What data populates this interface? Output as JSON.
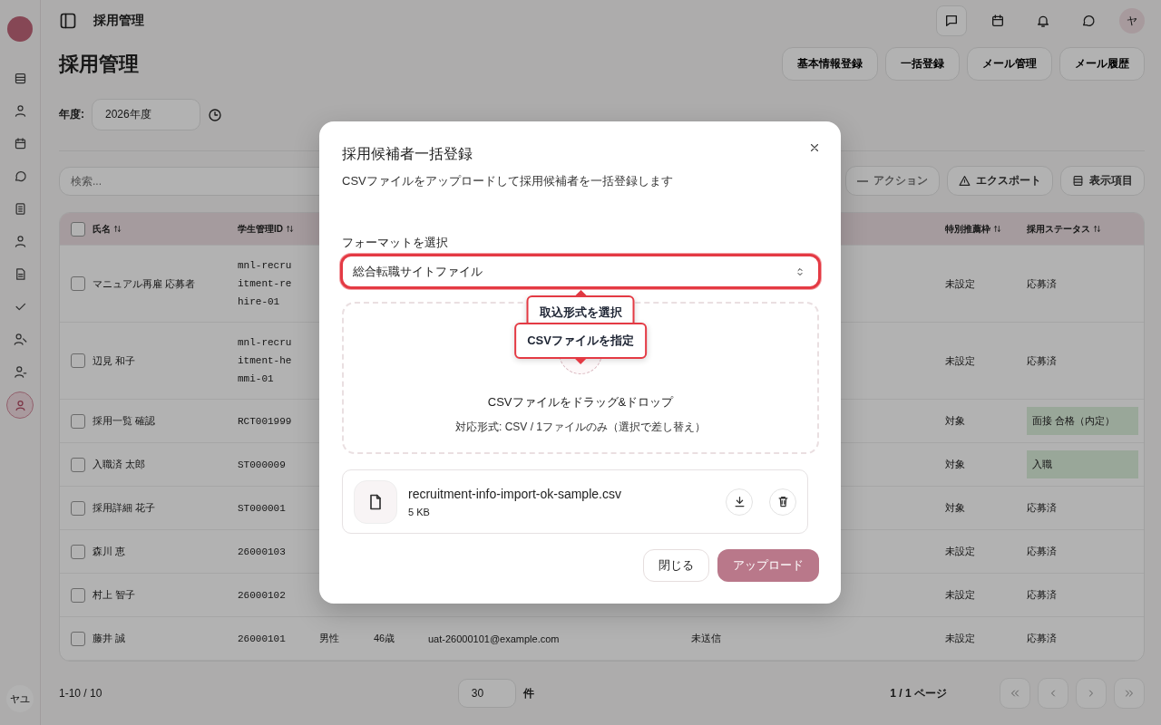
{
  "sidebar": {
    "items": [
      {
        "selected": false
      },
      {
        "selected": false
      },
      {
        "selected": false
      },
      {
        "selected": false
      },
      {
        "selected": false
      },
      {
        "selected": false
      },
      {
        "selected": false
      },
      {
        "selected": false
      },
      {
        "selected": false
      },
      {
        "selected": false
      },
      {
        "selected": true
      }
    ],
    "user": "ヤユ"
  },
  "header": {
    "title": "採用管理",
    "avatar": "ヤ"
  },
  "page": {
    "title": "採用管理",
    "actions": [
      "基本情報登録",
      "一括登録",
      "メール管理",
      "メール履歴"
    ],
    "year_label": "年度:",
    "year_value": "2026年度"
  },
  "toolbar": {
    "search_placeholder": "検索...",
    "buttons": [
      {
        "label": "アクション",
        "kind": "minus",
        "disabled": true
      },
      {
        "label": "エクスポート",
        "kind": "warning",
        "disabled": false
      },
      {
        "label": "表示項目",
        "kind": "columns",
        "disabled": false
      }
    ]
  },
  "table": {
    "select_all_checked": false,
    "columns": [
      "氏名",
      "学生管理ID",
      "特別推薦枠",
      "採用ステータス"
    ],
    "rows": [
      {
        "checked": false,
        "name": "マニュアル再雇 応募者",
        "id": "mnl-recruitment-rehire-01",
        "special": "未設定",
        "status": "応募済",
        "status_badge": false
      },
      {
        "checked": false,
        "name": "辺見 和子",
        "id": "mnl-recruitment-hemmi-01",
        "special": "未設定",
        "status": "応募済",
        "status_badge": false
      },
      {
        "checked": false,
        "name": "採用一覧 確認",
        "id": "RCT001999",
        "special": "対象",
        "status": "面接 合格（内定）",
        "status_badge": true
      },
      {
        "checked": false,
        "name": "入職済 太郎",
        "id": "ST000009",
        "special": "対象",
        "status": "入職",
        "status_badge": true
      },
      {
        "checked": false,
        "name": "採用詳細 花子",
        "id": "ST000001",
        "special": "対象",
        "status": "応募済",
        "status_badge": false
      },
      {
        "checked": false,
        "name": "森川 恵",
        "id": "26000103",
        "special": "未設定",
        "status": "応募済",
        "status_badge": false
      },
      {
        "checked": false,
        "name": "村上 智子",
        "id": "26000102",
        "special": "未設定",
        "status": "応募済",
        "status_badge": false
      },
      {
        "checked": false,
        "name": "藤井 誠",
        "id": "26000101",
        "gender": "男性",
        "age": "46歳",
        "email": "uat-26000101@example.com",
        "mail_status": "未送信",
        "special": "未設定",
        "status": "応募済",
        "status_badge": false
      }
    ]
  },
  "pagination": {
    "range": "1-10 / 10",
    "page_size": "30",
    "unit": "件",
    "page": "1 / 1 ページ"
  },
  "dialog": {
    "title": "採用候補者一括登録",
    "description": "CSVファイルをアップロードして採用候補者を一括登録します",
    "format_label": "フォーマットを選択",
    "format_value": "総合転職サイトファイル",
    "callouts": [
      "取込形式を選択",
      "CSVファイルを指定"
    ],
    "dropzone": {
      "title": "CSVファイルをドラッグ&ドロップ",
      "hint": "対応形式: CSV / 1ファイルのみ（選択で差し替え）"
    },
    "file": {
      "name": "recruitment-info-import-ok-sample.csv",
      "size": "5 KB"
    },
    "buttons": [
      {
        "label": "閉じる",
        "kind": "secondary"
      },
      {
        "label": "アップロード",
        "kind": "primary"
      }
    ]
  }
}
